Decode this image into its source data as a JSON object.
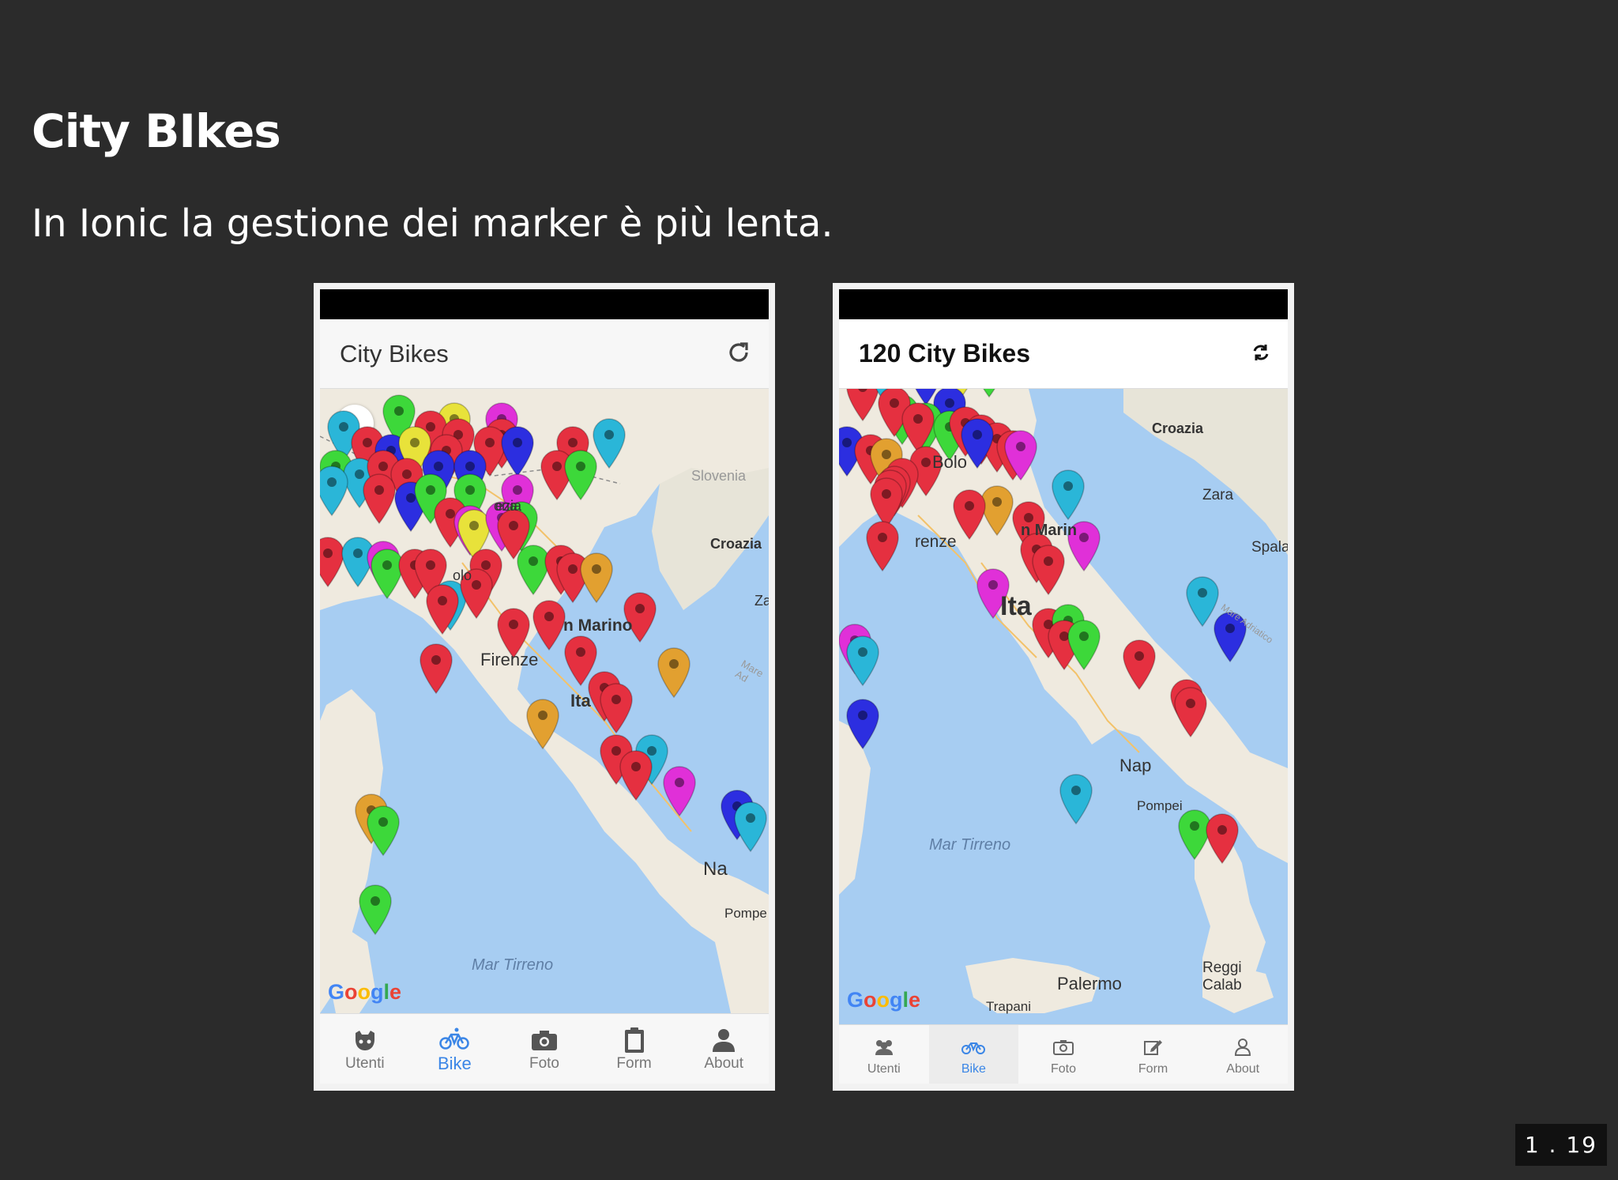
{
  "slide": {
    "title": "City BIkes",
    "subtitle": "In Ionic la gestione dei marker è più lenta.",
    "page_number": "1 . 19"
  },
  "colors": {
    "background": "#2b2b2b",
    "active_tab": "#3b86e6",
    "marker_red": "#e53040",
    "marker_green": "#3dd83a",
    "marker_blue": "#2c2ee0",
    "marker_cyan": "#2ab6d8",
    "marker_orange": "#e2a030",
    "marker_magenta": "#e030d8",
    "marker_yellow": "#e8e23a"
  },
  "left_app": {
    "header_title": "City Bikes",
    "header_icon": "refresh-icon",
    "map_labels": {
      "slovenia": "Slovenia",
      "croazia": "Croazia",
      "firenze": "Firenze",
      "san_marino": "n Marino",
      "italia": "Ita",
      "napoli": "Na",
      "pompei": "Pompe",
      "mar_tirreno": "Mar Tirreno",
      "venezia": "ezia",
      "verona": "ona",
      "bologna": "olo",
      "za": "Za",
      "mare_adriatico": "Mare Ad"
    },
    "tabs": [
      {
        "label": "Utenti",
        "icon": "github-icon",
        "active": false
      },
      {
        "label": "Bike",
        "icon": "bicycle-icon",
        "active": true
      },
      {
        "label": "Foto",
        "icon": "camera-icon",
        "active": false
      },
      {
        "label": "Form",
        "icon": "clipboard-icon",
        "active": false
      },
      {
        "label": "About",
        "icon": "person-icon",
        "active": false
      }
    ]
  },
  "right_app": {
    "header_title": "120 City Bikes",
    "header_icon": "refresh-icon",
    "map_labels": {
      "croazia": "Croazia",
      "zara": "Zara",
      "spalato": "Spala",
      "san_marino": "n Marin",
      "firenze": "renze",
      "italia": "Ita",
      "napoli": "Nap",
      "pompei": "Pompei",
      "mar_tirreno": "Mar Tirreno",
      "palermo": "Palermo",
      "trapani": "Trapani",
      "reggio": "Reggi",
      "calabria": "Calab",
      "bologna": "Bolo",
      "mare_adriatico": "Mare Adriatico"
    },
    "tabs": [
      {
        "label": "Utenti",
        "icon": "users-icon",
        "active": false
      },
      {
        "label": "Bike",
        "icon": "bicycle-icon",
        "active": true
      },
      {
        "label": "Foto",
        "icon": "camera-icon",
        "active": false
      },
      {
        "label": "Form",
        "icon": "edit-icon",
        "active": false
      },
      {
        "label": "About",
        "icon": "person-icon",
        "active": false
      }
    ]
  }
}
